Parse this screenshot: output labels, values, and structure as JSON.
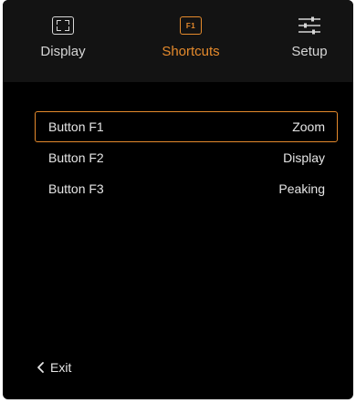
{
  "tabs": [
    {
      "label": "Display",
      "icon": "display-icon"
    },
    {
      "label": "Shortcuts",
      "icon": "f1-icon",
      "icon_text": "F1",
      "active": true
    },
    {
      "label": "Setup",
      "icon": "sliders-icon"
    }
  ],
  "shortcuts": [
    {
      "button": "Button F1",
      "function": "Zoom",
      "selected": true
    },
    {
      "button": "Button F2",
      "function": "Display"
    },
    {
      "button": "Button F3",
      "function": "Peaking"
    }
  ],
  "footer": {
    "exit_label": "Exit"
  },
  "colors": {
    "accent": "#e58a2c",
    "text": "#e6e6e6",
    "header_bg": "#131313",
    "bg": "#000000"
  }
}
